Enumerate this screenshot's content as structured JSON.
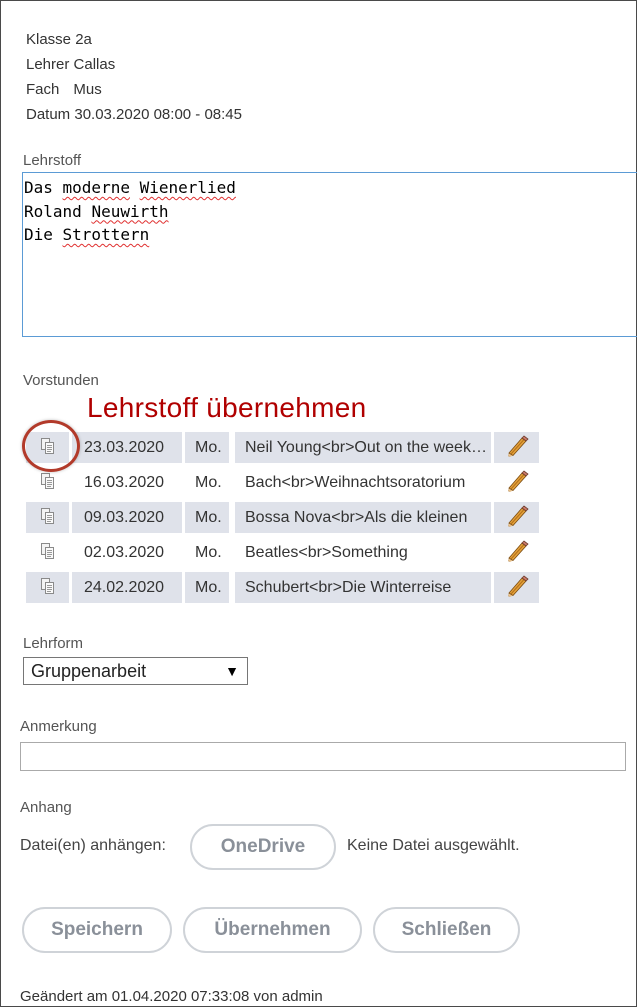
{
  "info": {
    "klasse": "Klasse 2a",
    "lehrer": "Lehrer Callas",
    "fach_label": "Fach",
    "fach_value": "Mus",
    "datum": "Datum 30.03.2020 08:00 - 08:45"
  },
  "lehrstoff": {
    "label": "Lehrstoff",
    "lines": [
      [
        "Das ",
        "moderne",
        " ",
        "Wienerlied",
        ""
      ],
      [
        "Roland ",
        "Neuwirth",
        "",
        "",
        ""
      ],
      [
        "Die ",
        "Strottern",
        "",
        "",
        ""
      ]
    ]
  },
  "vorstunden": {
    "label": "Vorstunden",
    "annotation": "Lehrstoff übernehmen",
    "rows": [
      {
        "date": "23.03.2020",
        "day": "Mo.",
        "text": "Neil Young<br>Out on the weekend"
      },
      {
        "date": "16.03.2020",
        "day": "Mo.",
        "text": "Bach<br>Weihnachtsoratorium"
      },
      {
        "date": "09.03.2020",
        "day": "Mo.",
        "text": "Bossa Nova<br>Als die kleinen"
      },
      {
        "date": "02.03.2020",
        "day": "Mo.",
        "text": "Beatles<br>Something"
      },
      {
        "date": "24.02.2020",
        "day": "Mo.",
        "text": "Schubert<br>Die Winterreise"
      }
    ],
    "copy_icon": "copy-icon",
    "edit_icon": "pencil-icon"
  },
  "lehrform": {
    "label": "Lehrform",
    "selected": "Gruppenarbeit"
  },
  "anmerkung": {
    "label": "Anmerkung",
    "value": ""
  },
  "anhang": {
    "label": "Anhang",
    "datei_label": "Datei(en) anhängen:",
    "onedrive": "OneDrive",
    "no_file": "Keine Datei ausgewählt."
  },
  "buttons": {
    "save": "Speichern",
    "apply": "Übernehmen",
    "close": "Schließen"
  },
  "footer": "Geändert am 01.04.2020 07:33:08 von admin",
  "colors": {
    "annotation": "#b00000",
    "row_shade": "#dfe2ea",
    "focus_border": "#5b9bd5"
  }
}
